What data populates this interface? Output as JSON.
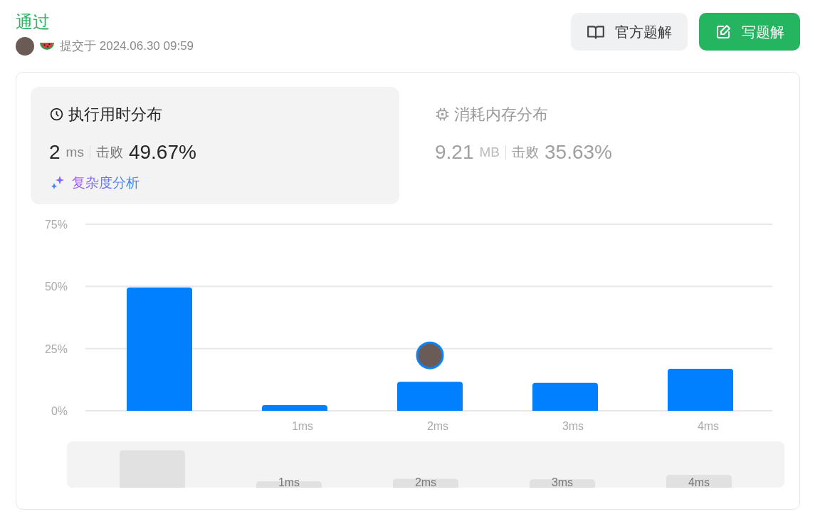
{
  "header": {
    "status": "通过",
    "submitted": "提交于 2024.06.30 09:59"
  },
  "buttons": [
    {
      "label": "官方题解",
      "kind": "secondary"
    },
    {
      "label": "写题解",
      "kind": "primary"
    }
  ],
  "tabs": [
    {
      "title": "执行用时分布",
      "value": "2",
      "unit": "ms",
      "beat_label": "击败",
      "percent": "49.67%",
      "link": "复杂度分析",
      "selected": true,
      "kind": "time"
    },
    {
      "title": "消耗内存分布",
      "value": "9.21",
      "unit": "MB",
      "beat_label": "击败",
      "percent": "35.63%",
      "selected": false,
      "kind": "memory"
    }
  ],
  "chart_data": {
    "type": "bar",
    "categories": [
      null,
      "1ms",
      "2ms",
      "3ms",
      "4ms"
    ],
    "series": [
      {
        "color": "#0080ff",
        "values": [
          49.6,
          2.3,
          11.7,
          11.2,
          16.9
        ]
      }
    ],
    "ylim": [
      0,
      75
    ],
    "yticks": [
      {
        "value": 0,
        "label": "0%"
      },
      {
        "value": 25,
        "label": "25%"
      },
      {
        "value": 50,
        "label": "50%"
      },
      {
        "value": 75,
        "label": "75%"
      }
    ],
    "annotations": [
      {
        "x": "2ms"
      }
    ]
  },
  "overview": {
    "labels": [
      "1ms",
      "2ms",
      "3ms",
      "4ms"
    ]
  }
}
